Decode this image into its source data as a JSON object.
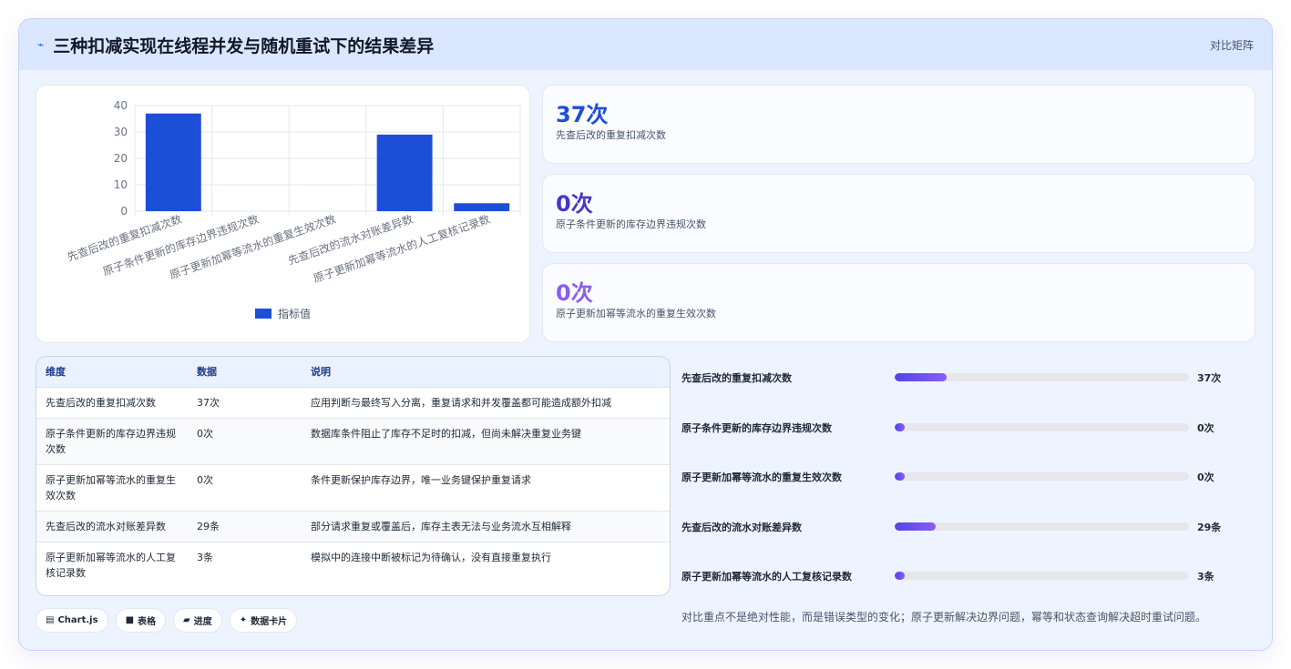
{
  "header": {
    "title": "三种扣减实现在线程并发与随机重试下的结果差异",
    "tag": "对比矩阵",
    "icon": "pulse-icon"
  },
  "chart_data": {
    "type": "bar",
    "categories": [
      "先查后改的重复扣减次数",
      "原子条件更新的库存边界违规次数",
      "原子更新加幂等流水的重复生效次数",
      "先查后改的流水对账差异数",
      "原子更新加幂等流水的人工复核记录数"
    ],
    "series": [
      {
        "name": "指标值",
        "values": [
          37,
          0,
          0,
          29,
          3
        ]
      }
    ],
    "ylim": [
      0,
      40
    ],
    "yticks": [
      0,
      10,
      20,
      30,
      40
    ],
    "grid": true,
    "legend": "bottom",
    "color": "#1d4ed8"
  },
  "stats": [
    {
      "value": "37次",
      "label": "先查后改的重复扣减次数",
      "color": "#1d4ed8"
    },
    {
      "value": "0次",
      "label": "原子条件更新的库存边界违规次数",
      "color": "#4338ca"
    },
    {
      "value": "0次",
      "label": "原子更新加幂等流水的重复生效次数",
      "color": "#8b5cf6"
    }
  ],
  "table": {
    "headers": [
      "维度",
      "数据",
      "说明"
    ],
    "rows": [
      [
        "先查后改的重复扣减次数",
        "37次",
        "应用判断与最终写入分离，重复请求和并发覆盖都可能造成额外扣减"
      ],
      [
        "原子条件更新的库存边界违规次数",
        "0次",
        "数据库条件阻止了库存不足时的扣减，但尚未解决重复业务键"
      ],
      [
        "原子更新加幂等流水的重复生效次数",
        "0次",
        "条件更新保护库存边界，唯一业务键保护重复请求"
      ],
      [
        "先查后改的流水对账差异数",
        "29条",
        "部分请求重复或覆盖后，库存主表无法与业务流水互相解释"
      ],
      [
        "原子更新加幂等流水的人工复核记录数",
        "3条",
        "模拟中的连接中断被标记为待确认，没有直接重复执行"
      ]
    ]
  },
  "progress": [
    {
      "label": "先查后改的重复扣减次数",
      "value": 37,
      "display": "37次"
    },
    {
      "label": "原子条件更新的库存边界违规次数",
      "value": 0,
      "display": "0次"
    },
    {
      "label": "原子更新加幂等流水的重复生效次数",
      "value": 0,
      "display": "0次"
    },
    {
      "label": "先查后改的流水对账差异数",
      "value": 29,
      "display": "29条"
    },
    {
      "label": "原子更新加幂等流水的人工复核记录数",
      "value": 3,
      "display": "3条"
    }
  ],
  "progress_max": 210,
  "pills": [
    {
      "icon": "▤",
      "label": "Chart.js"
    },
    {
      "icon": "■",
      "label": "表格"
    },
    {
      "icon": "▰",
      "label": "进度"
    },
    {
      "icon": "✦",
      "label": "数据卡片"
    }
  ],
  "note": "对比重点不是绝对性能，而是错误类型的变化；原子更新解决边界问题，幂等和状态查询解决超时重试问题。"
}
